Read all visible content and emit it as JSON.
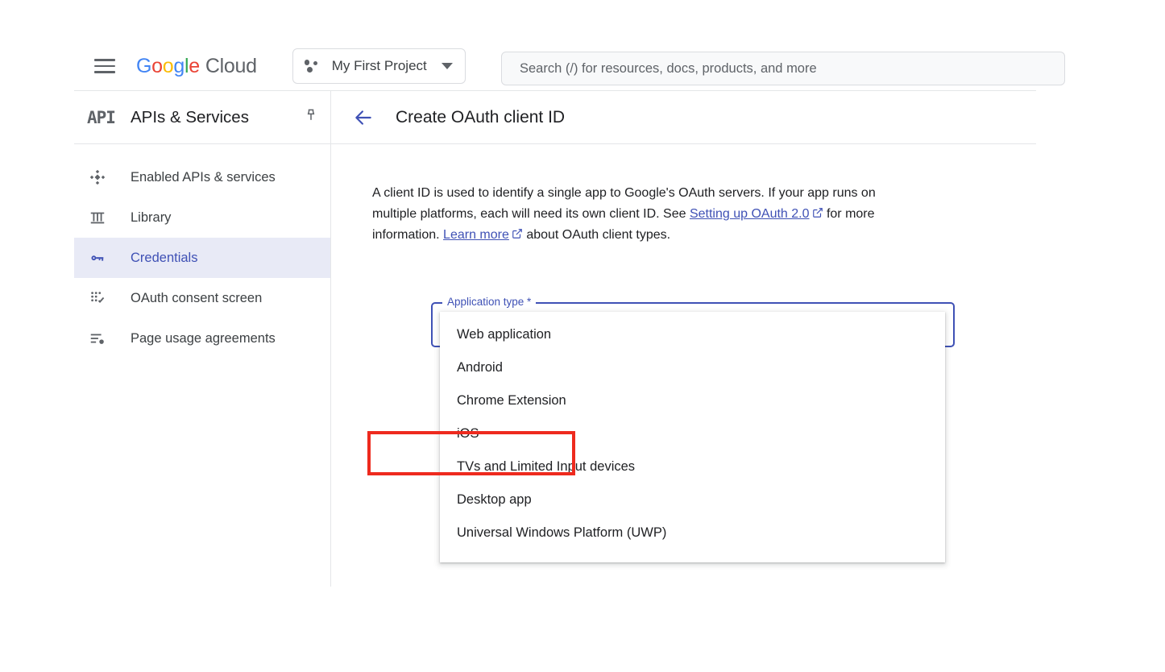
{
  "topbar": {
    "menu_icon": "hamburger-menu-icon",
    "brand": {
      "g_letters": [
        "G",
        "o",
        "o",
        "g",
        "l",
        "e"
      ],
      "cloud": "Cloud"
    },
    "project_selector": {
      "icon": "project-dots-icon",
      "name": "My First Project",
      "caret": "chevron-down-icon"
    },
    "search": {
      "placeholder": "Search (/) for resources, docs, products, and more",
      "icon": "search-icon"
    }
  },
  "sidebar": {
    "product_mark": "API",
    "title": "APIs & Services",
    "pin_icon": "pin-icon",
    "items": [
      {
        "label": "Enabled APIs & services",
        "icon": "enabled-apis-icon",
        "active": false
      },
      {
        "label": "Library",
        "icon": "library-icon",
        "active": false
      },
      {
        "label": "Credentials",
        "icon": "key-icon",
        "active": true
      },
      {
        "label": "OAuth consent screen",
        "icon": "consent-screen-icon",
        "active": false
      },
      {
        "label": "Page usage agreements",
        "icon": "agreements-icon",
        "active": false
      }
    ]
  },
  "main": {
    "back_icon": "back-arrow-icon",
    "title": "Create OAuth client ID",
    "description": {
      "part1": "A client ID is used to identify a single app to Google's OAuth servers. If your app runs on multiple platforms, each will need its own client ID. See ",
      "link1": "Setting up OAuth 2.0",
      "part2": " for more information. ",
      "link2": "Learn more",
      "part3": " about OAuth client types.",
      "external_icon": "external-link-icon"
    },
    "form": {
      "field_label": "Application type *",
      "field_value": "",
      "dropdown_open": true,
      "options": [
        "Web application",
        "Android",
        "Chrome Extension",
        "iOS",
        "TVs and Limited Input devices",
        "Desktop app",
        "Universal Windows Platform (UWP)"
      ],
      "highlighted_option": "Desktop app"
    }
  },
  "annotation": {
    "target": "Desktop app",
    "color": "#ee2a1e"
  },
  "colors": {
    "accent_blue": "#3f51b5",
    "active_bg": "#e8eaf6",
    "text_primary": "#202124",
    "text_secondary": "#5f6368",
    "border": "#dadce0",
    "annotation_red": "#ee2a1e"
  }
}
